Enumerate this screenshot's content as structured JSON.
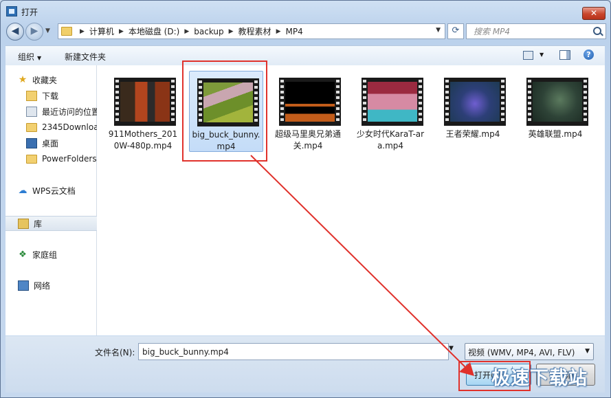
{
  "window": {
    "title": "打开",
    "close_label": "✕"
  },
  "nav": {
    "back_glyph": "◀",
    "forward_glyph": "▶",
    "breadcrumb": [
      "计算机",
      "本地磁盘 (D:)",
      "backup",
      "教程素材",
      "MP4"
    ],
    "refresh_glyph": "⟳",
    "search_placeholder": "搜索 MP4"
  },
  "toolbar": {
    "organize": "组织",
    "new_folder": "新建文件夹",
    "help_glyph": "?"
  },
  "sidebar": {
    "items": [
      {
        "label": "收藏夹",
        "icon": "star-icon"
      },
      {
        "label": "下载",
        "icon": "download-folder-icon"
      },
      {
        "label": "最近访问的位置",
        "icon": "recent-places-icon"
      },
      {
        "label": "2345Downloa",
        "icon": "folder-icon"
      },
      {
        "label": "桌面",
        "icon": "desktop-icon"
      },
      {
        "label": "PowerFolders",
        "icon": "folder-icon"
      },
      {
        "label": "WPS云文档",
        "icon": "cloud-icon"
      },
      {
        "label": "库",
        "icon": "library-icon"
      },
      {
        "label": "家庭组",
        "icon": "homegroup-icon"
      },
      {
        "label": "网络",
        "icon": "network-icon"
      }
    ]
  },
  "files": [
    {
      "name": "911Mothers_2010W-480p.mp4",
      "selected": false
    },
    {
      "name": "big_buck_bunny.mp4",
      "selected": true
    },
    {
      "name": "超级马里奥兄弟通关.mp4",
      "selected": false
    },
    {
      "name": "少女时代KaraT-ara.mp4",
      "selected": false
    },
    {
      "name": "王者荣耀.mp4",
      "selected": false
    },
    {
      "name": "英雄联盟.mp4",
      "selected": false
    }
  ],
  "file_labels": {
    "f0": "911Mothers_2010W-480p.mp4",
    "f1": "big_buck_bunny.mp4",
    "f2": "超级马里奥兄弟通关.mp4",
    "f3": "少女时代KaraT-ara.mp4",
    "f4": "王者荣耀.mp4",
    "f5": "英雄联盟.mp4"
  },
  "footer": {
    "filename_label": "文件名(N):",
    "filename_value": "big_buck_bunny.mp4",
    "filter_label": "视频 (WMV, MP4, AVI, FLV)",
    "open_label": "打开(O)",
    "cancel_label": "取消"
  },
  "watermark": "极速下载站",
  "colors": {
    "highlight": "#e0312b",
    "selection": "#c4dcf8",
    "accent": "#3c7fb1"
  }
}
